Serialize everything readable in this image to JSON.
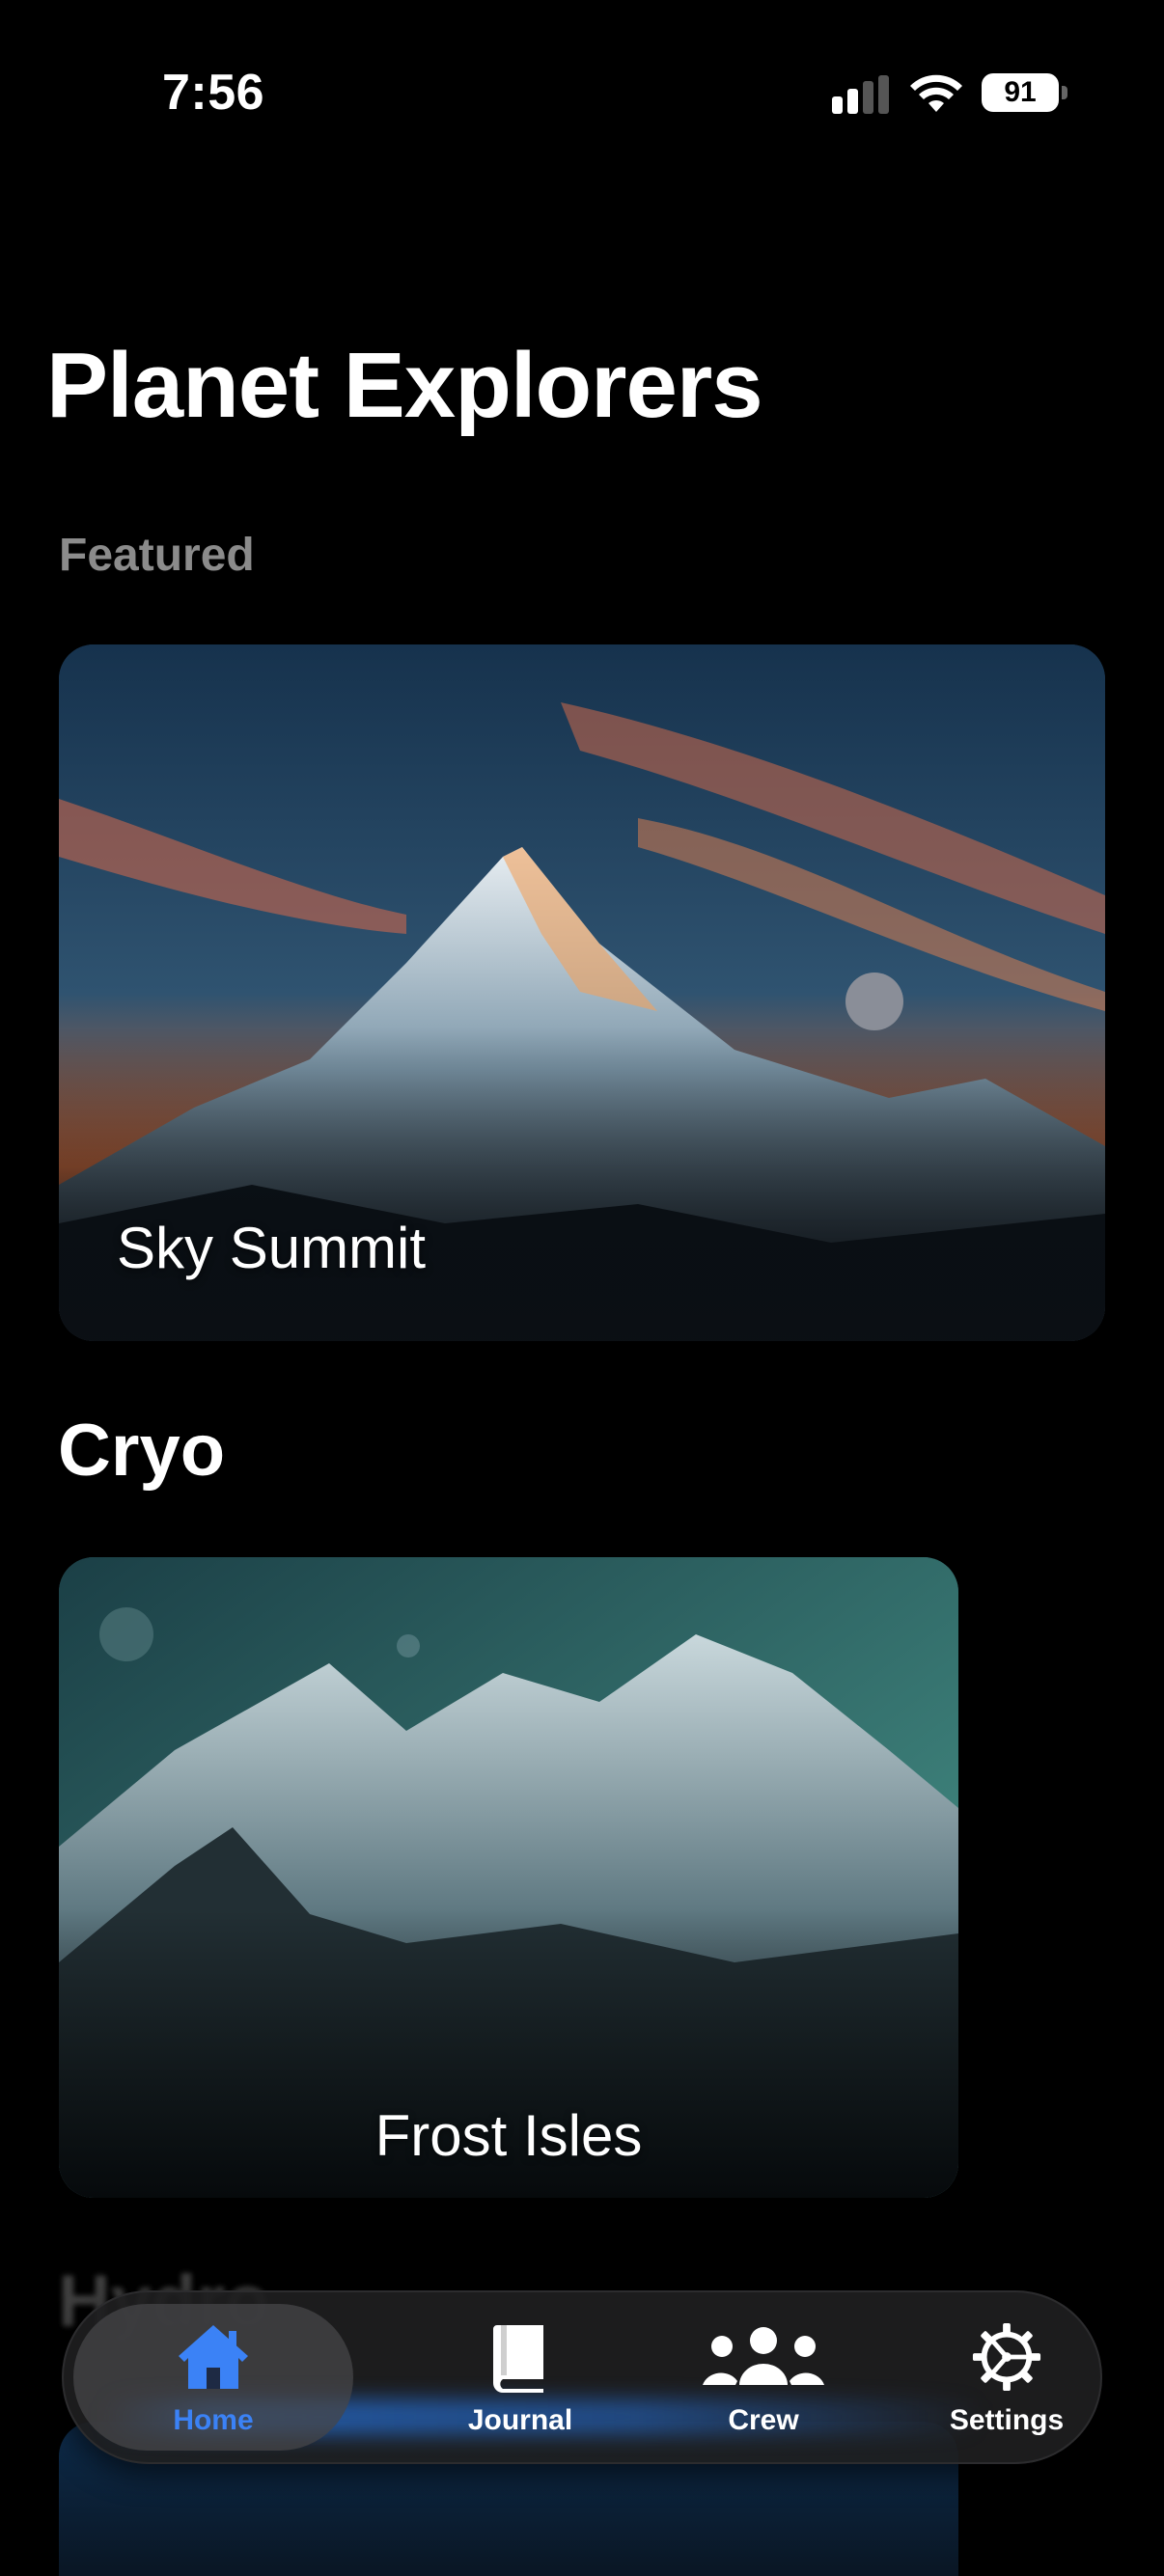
{
  "status": {
    "time": "7:56",
    "battery": "91"
  },
  "title": "Planet Explorers",
  "featured": {
    "heading": "Featured",
    "card_label": "Sky Summit"
  },
  "cryo": {
    "heading": "Cryo",
    "card_label": "Frost Isles"
  },
  "next_section": {
    "heading": "Hydro"
  },
  "tabs": [
    {
      "label": "Home",
      "icon": "house-icon",
      "active": true
    },
    {
      "label": "Journal",
      "icon": "book-icon",
      "active": false
    },
    {
      "label": "Crew",
      "icon": "people-icon",
      "active": false
    },
    {
      "label": "Settings",
      "icon": "gear-icon",
      "active": false
    }
  ],
  "colors": {
    "accent": "#3b82f6",
    "background": "#000000",
    "section_label": "#8b8b8b"
  }
}
